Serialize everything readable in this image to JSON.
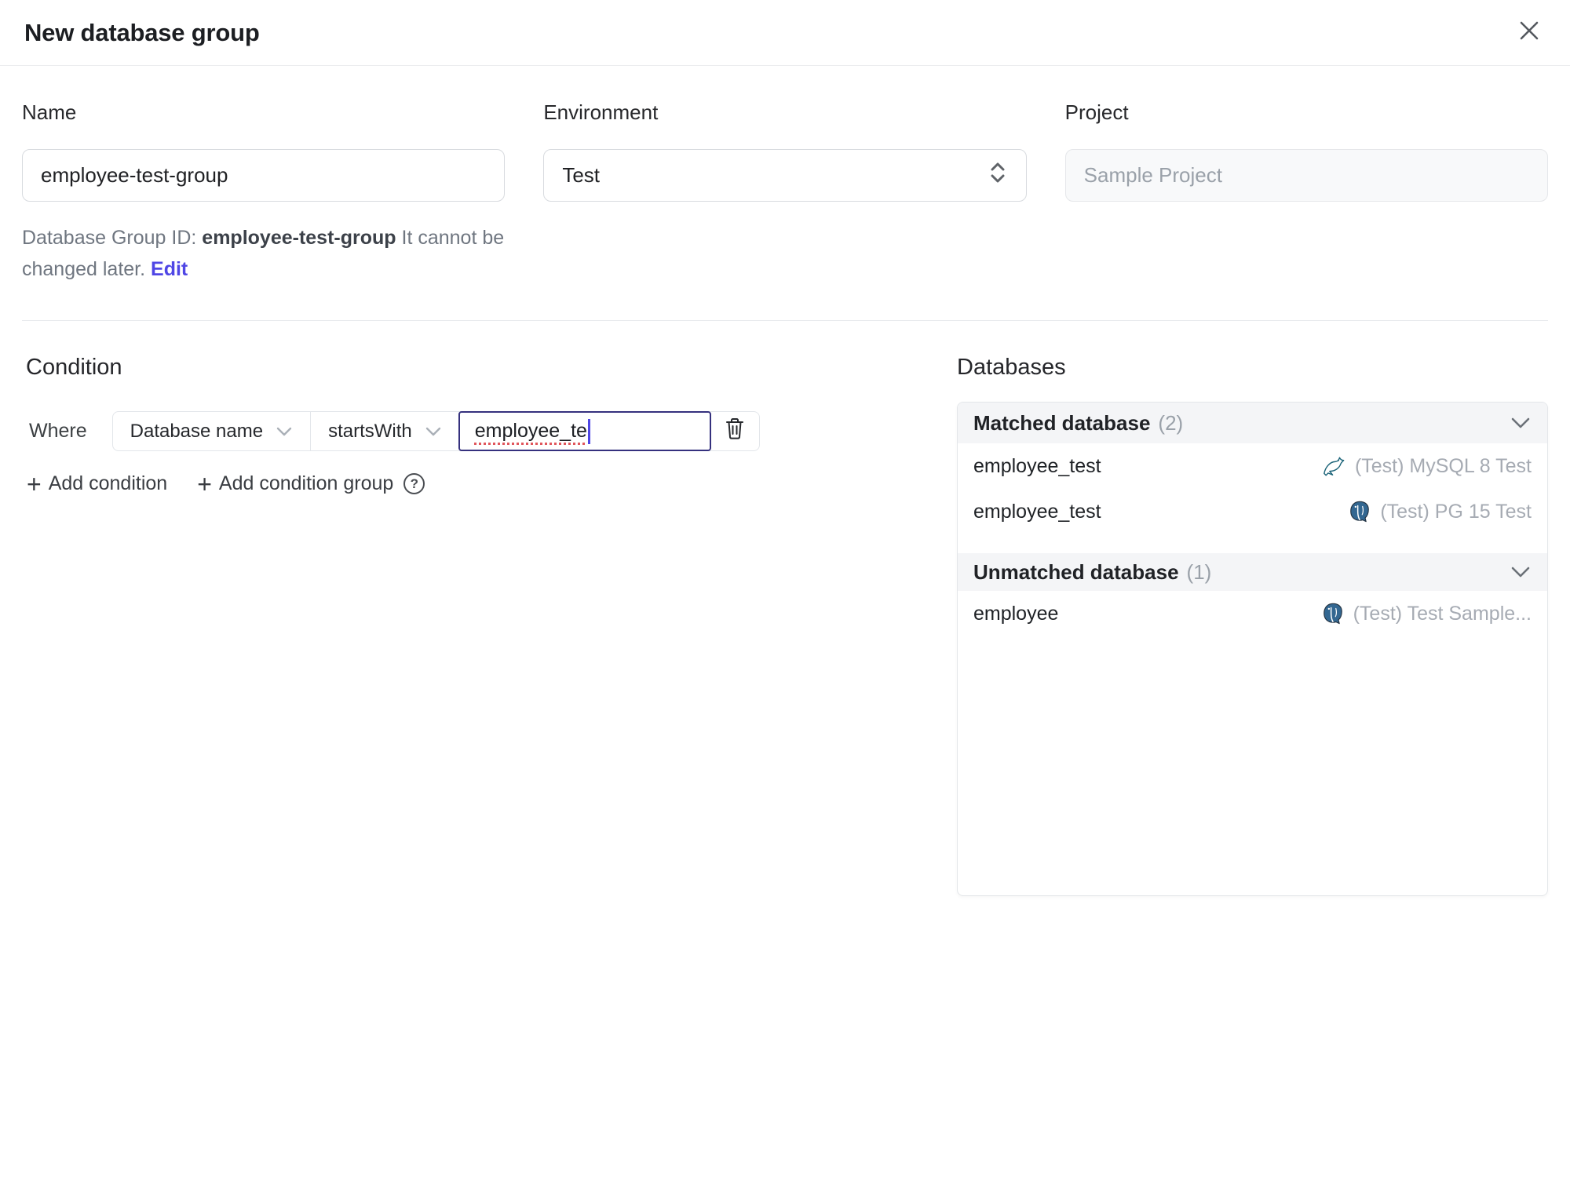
{
  "dialog": {
    "title": "New database group"
  },
  "form": {
    "name": {
      "label": "Name",
      "value": "employee-test-group"
    },
    "environment": {
      "label": "Environment",
      "value": "Test"
    },
    "project": {
      "label": "Project",
      "value": "Sample Project"
    },
    "id_note": {
      "prefix": "Database Group ID: ",
      "id": "employee-test-group",
      "middle": " It cannot be changed later. ",
      "edit": "Edit"
    }
  },
  "condition": {
    "heading": "Condition",
    "where": "Where",
    "field": "Database name",
    "operator": "startsWith",
    "value": "employee_te",
    "plus": "+",
    "add_condition": "Add condition",
    "add_condition_group": "Add condition group",
    "help": "?"
  },
  "databases": {
    "heading": "Databases",
    "groups": [
      {
        "title": "Matched database",
        "count": "(2)",
        "rows": [
          {
            "name": "employee_test",
            "engine": "mysql",
            "instance": "(Test) MySQL 8 Test"
          },
          {
            "name": "employee_test",
            "engine": "postgresql",
            "instance": "(Test) PG 15 Test"
          }
        ]
      },
      {
        "title": "Unmatched database",
        "count": "(1)",
        "rows": [
          {
            "name": "employee",
            "engine": "postgresql",
            "instance": "(Test) Test Sample..."
          }
        ]
      }
    ]
  },
  "colors": {
    "accent": "#4f46e5",
    "focus_border": "#35317e",
    "mysql": "#1a6378",
    "postgresql": "#336791"
  }
}
